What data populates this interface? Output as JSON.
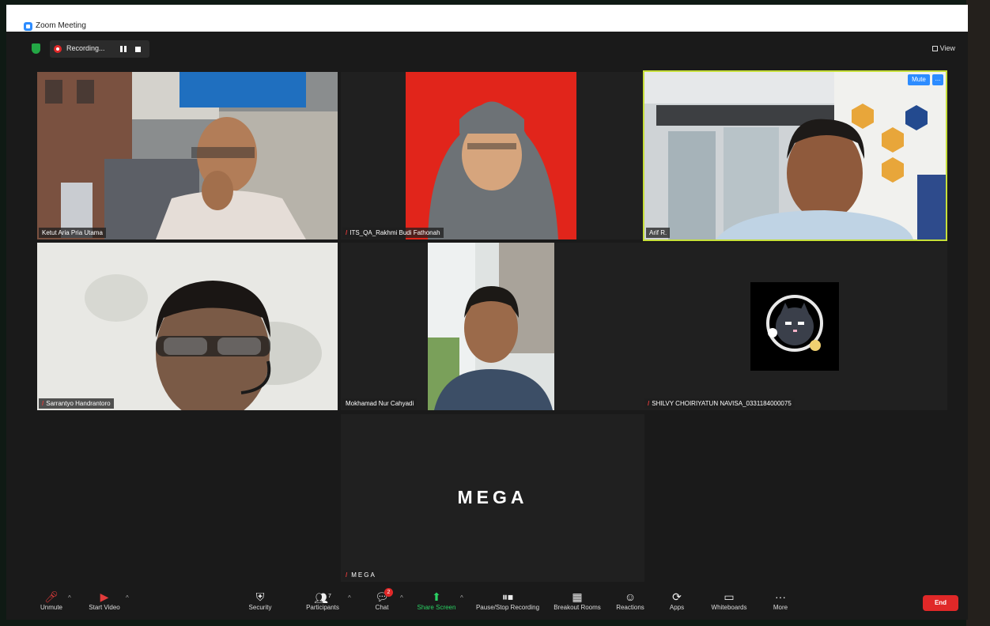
{
  "window": {
    "title": "Zoom Meeting"
  },
  "topbar": {
    "recording_label": "Recording...",
    "view_label": "View"
  },
  "participants": [
    {
      "name": "Ketut Aria Pria Utama"
    },
    {
      "name": "ITS_QA_Rakhmi Budi Fathonah"
    },
    {
      "name": "Arif R."
    },
    {
      "name": "Sarrantyo Handrantoro"
    },
    {
      "name": "Mokhamad Nur Cahyadi"
    },
    {
      "name": "SHILVY CHOIRIYATUN NAVISA_0331184000075"
    },
    {
      "name": "MEGA",
      "avatar_text": "MEGA"
    }
  ],
  "active_tile": {
    "mute_label": "Mute",
    "more_label": "..."
  },
  "toolbar": {
    "unmute": "Unmute",
    "start_video": "Start Video",
    "security": "Security",
    "participants": "Participants",
    "participants_count": "7",
    "chat": "Chat",
    "chat_badge": "2",
    "share_screen": "Share Screen",
    "pause_stop_recording": "Pause/Stop Recording",
    "breakout_rooms": "Breakout Rooms",
    "reactions": "Reactions",
    "apps": "Apps",
    "whiteboards": "Whiteboards",
    "more": "More",
    "end": "End"
  },
  "colors": {
    "active_speaker": "#c6df3a",
    "accent": "#2d8cff",
    "end": "#e02828",
    "share": "#2ad163"
  }
}
